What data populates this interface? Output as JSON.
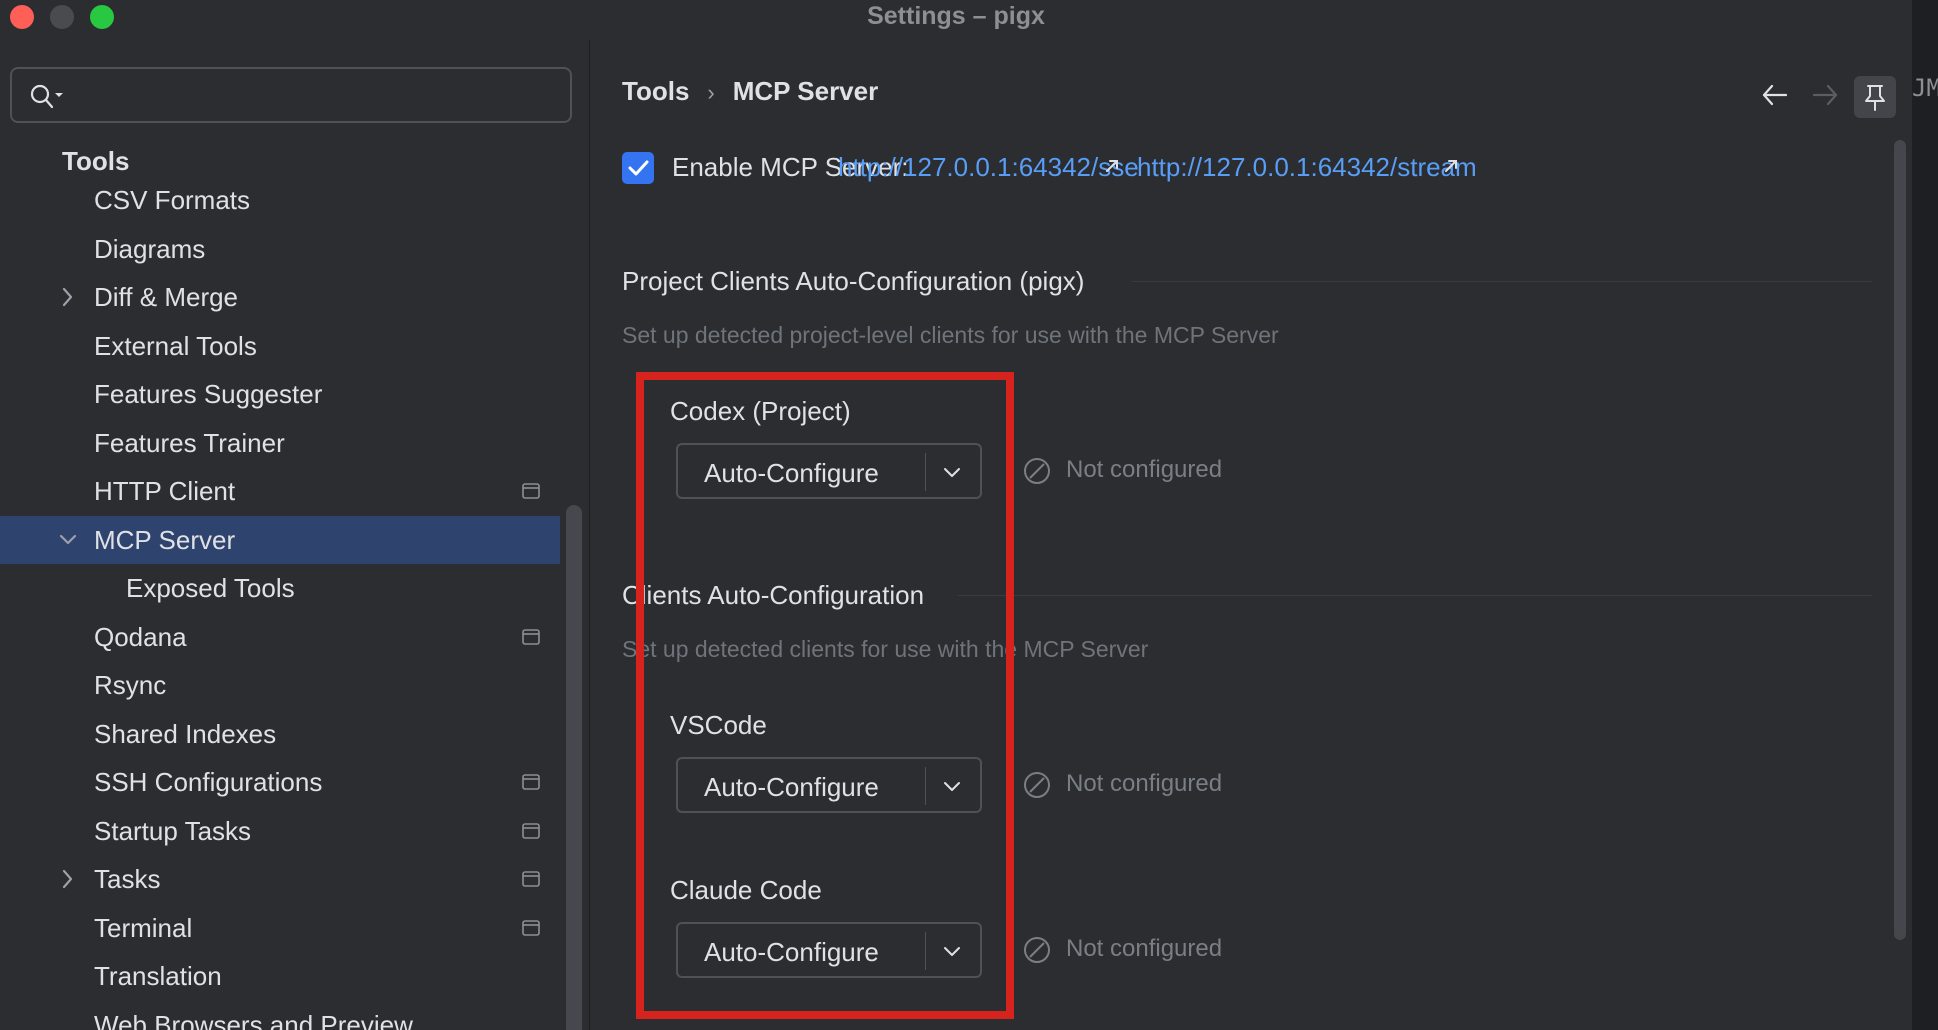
{
  "window": {
    "title": "Settings – pigx"
  },
  "right_strip": {
    "glyph": "JM"
  },
  "sidebar": {
    "search_placeholder": "",
    "header": "Tools",
    "items": [
      {
        "label": "CSV Formats",
        "expandable": false,
        "project_icon": false
      },
      {
        "label": "Diagrams",
        "expandable": false,
        "project_icon": false
      },
      {
        "label": "Diff & Merge",
        "expandable": true,
        "project_icon": false
      },
      {
        "label": "External Tools",
        "expandable": false,
        "project_icon": false
      },
      {
        "label": "Features Suggester",
        "expandable": false,
        "project_icon": false
      },
      {
        "label": "Features Trainer",
        "expandable": false,
        "project_icon": false
      },
      {
        "label": "HTTP Client",
        "expandable": false,
        "project_icon": true
      },
      {
        "label": "MCP Server",
        "expandable": true,
        "expanded": true,
        "selected": true,
        "project_icon": false
      },
      {
        "label": "Exposed Tools",
        "expandable": false,
        "child": true,
        "project_icon": false
      },
      {
        "label": "Qodana",
        "expandable": false,
        "project_icon": true
      },
      {
        "label": "Rsync",
        "expandable": false,
        "project_icon": false
      },
      {
        "label": "Shared Indexes",
        "expandable": false,
        "project_icon": false
      },
      {
        "label": "SSH Configurations",
        "expandable": false,
        "project_icon": true
      },
      {
        "label": "Startup Tasks",
        "expandable": false,
        "project_icon": true
      },
      {
        "label": "Tasks",
        "expandable": true,
        "project_icon": true
      },
      {
        "label": "Terminal",
        "expandable": false,
        "project_icon": true
      },
      {
        "label": "Translation",
        "expandable": false,
        "project_icon": false
      },
      {
        "label": "Web Browsers and Preview",
        "expandable": false,
        "project_icon": false
      }
    ]
  },
  "main": {
    "breadcrumb": {
      "parent": "Tools",
      "separator": "›",
      "current": "MCP Server"
    },
    "enable": {
      "checked": true,
      "label": "Enable MCP Server:",
      "sse_url": "http://127.0.0.1:64342/sse",
      "stream_url": "http://127.0.0.1:64342/stream"
    },
    "project_section": {
      "title": "Project Clients Auto-Configuration (pigx)",
      "description": "Set up detected project-level clients for use with the MCP Server",
      "clients": [
        {
          "name": "Codex (Project)",
          "action": "Auto-Configure",
          "status": "Not configured"
        }
      ]
    },
    "clients_section": {
      "title": "Clients Auto-Configuration",
      "description": "Set up detected clients for use with the MCP Server",
      "clients": [
        {
          "name": "VSCode",
          "action": "Auto-Configure",
          "status": "Not configured"
        },
        {
          "name": "Claude Code",
          "action": "Auto-Configure",
          "status": "Not configured"
        }
      ]
    }
  },
  "colors": {
    "accent": "#3574f0",
    "link": "#589df6",
    "selection": "#2e436e",
    "highlight_box": "#d7231e"
  }
}
